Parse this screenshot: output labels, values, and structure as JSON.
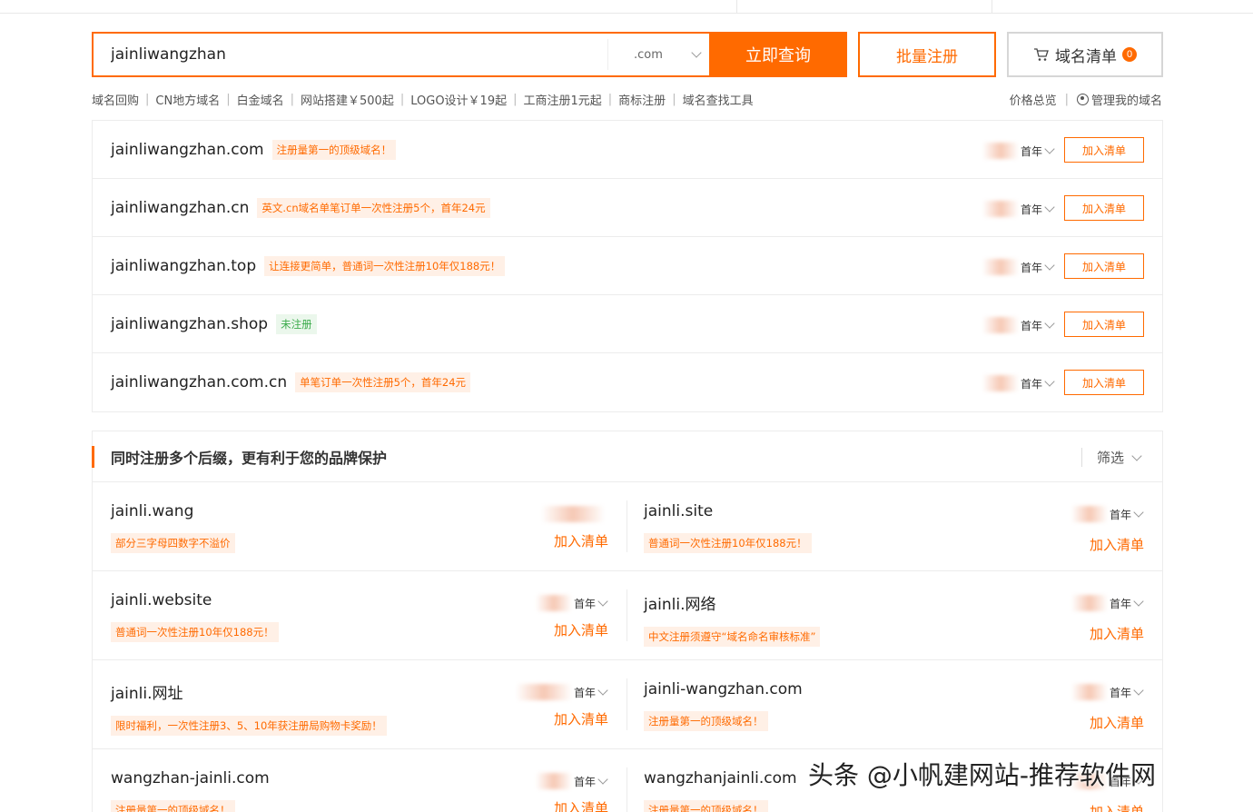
{
  "search": {
    "query": "jainliwangzhan",
    "suffix": ".com",
    "search_button": "立即查询",
    "batch_button": "批量注册",
    "cart_label": "域名清单",
    "cart_count": "0"
  },
  "quick_links": [
    "域名回购",
    "CN地方域名",
    "白金域名",
    "网站搭建￥500起",
    "LOGO设计￥19起",
    "工商注册1元起",
    "商标注册",
    "域名查找工具"
  ],
  "right_links": [
    "价格总览",
    "管理我的域名"
  ],
  "results": [
    {
      "domain": "jainliwangzhan.com",
      "tag": "注册量第一的顶级域名！",
      "tag_type": "orange",
      "year": "首年",
      "add": "加入清单"
    },
    {
      "domain": "jainliwangzhan.cn",
      "tag": "英文.cn域名单笔订单一次性注册5个，首年24元",
      "tag_type": "orange",
      "year": "首年",
      "add": "加入清单"
    },
    {
      "domain": "jainliwangzhan.top",
      "tag": "让连接更简单，普通词一次性注册10年仅188元！",
      "tag_type": "orange",
      "year": "首年",
      "add": "加入清单"
    },
    {
      "domain": "jainliwangzhan.shop",
      "tag": "未注册",
      "tag_type": "green",
      "year": "首年",
      "add": "加入清单"
    },
    {
      "domain": "jainliwangzhan.com.cn",
      "tag": "单笔订单一次性注册5个，首年24元",
      "tag_type": "orange",
      "year": "首年",
      "add": "加入清单"
    }
  ],
  "multi": {
    "title": "同时注册多个后缀，更有利于您的品牌保护",
    "filter": "筛选",
    "rows": [
      [
        {
          "name": "jainli.wang",
          "tag": "部分三字母四数字不溢价",
          "year": "",
          "add": "加入清单"
        },
        {
          "name": "jainli.site",
          "tag": "普通词一次性注册10年仅188元！",
          "year": "首年",
          "add": "加入清单"
        }
      ],
      [
        {
          "name": "jainli.website",
          "tag": "普通词一次性注册10年仅188元！",
          "year": "首年",
          "add": "加入清单"
        },
        {
          "name": "jainli.网络",
          "tag": "中文注册须遵守“域名命名审核标准”",
          "year": "首年",
          "add": "加入清单"
        }
      ],
      [
        {
          "name": "jainli.网址",
          "tag": "限时福利，一次性注册3、5、10年获注册局购物卡奖励！",
          "year": "首年",
          "add": "加入清单"
        },
        {
          "name": "jainli-wangzhan.com",
          "tag": "注册量第一的顶级域名！",
          "year": "首年",
          "add": "加入清单"
        }
      ],
      [
        {
          "name": "wangzhan-jainli.com",
          "tag": "注册量第一的顶级域名！",
          "year": "首年",
          "add": "加入清单"
        },
        {
          "name": "wangzhanjainli.com",
          "tag": "注册量第一的顶级域名！",
          "year": "首年",
          "add": "加入清单"
        }
      ]
    ]
  },
  "watermark": "头条 @小帆建网站-推荐软件网"
}
